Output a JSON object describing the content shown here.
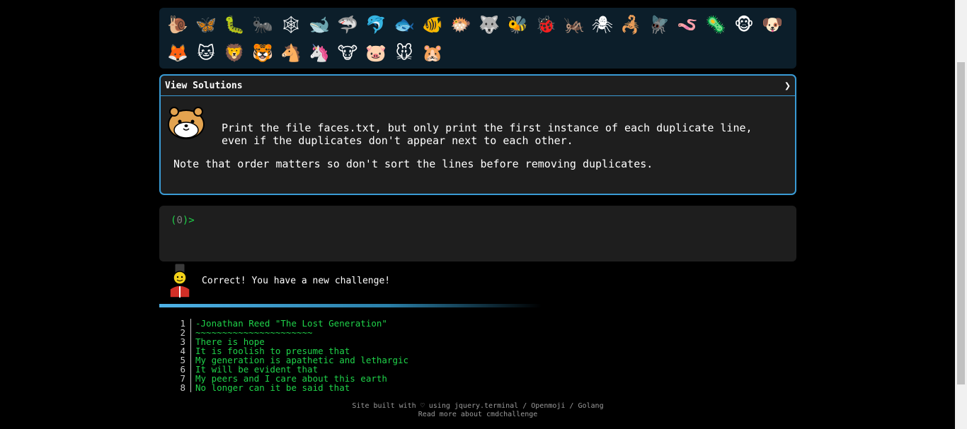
{
  "emoji_panel": {
    "icons": [
      {
        "name": "snail-icon",
        "glyph": "🐌"
      },
      {
        "name": "butterfly-icon",
        "glyph": "🦋"
      },
      {
        "name": "caterpillar-icon",
        "glyph": "🐛"
      },
      {
        "name": "ant-icon",
        "glyph": "🐜"
      },
      {
        "name": "spider-web-icon",
        "glyph": "🕸"
      },
      {
        "name": "whale-icon",
        "glyph": "🐋"
      },
      {
        "name": "shark-icon",
        "glyph": "🦈"
      },
      {
        "name": "dolphin-icon",
        "glyph": "🐬"
      },
      {
        "name": "fish-icon",
        "glyph": "🐟"
      },
      {
        "name": "tropical-fish-icon",
        "glyph": "🐠"
      },
      {
        "name": "blowfish-icon",
        "glyph": "🐡"
      },
      {
        "name": "wolf-icon",
        "glyph": "🐺"
      },
      {
        "name": "bee-icon",
        "glyph": "🐝"
      },
      {
        "name": "ladybug-icon",
        "glyph": "🐞"
      },
      {
        "name": "cricket-icon",
        "glyph": "🦗"
      },
      {
        "name": "spider-icon",
        "glyph": "🕷"
      },
      {
        "name": "scorpion-icon",
        "glyph": "🦂"
      },
      {
        "name": "fly-icon",
        "glyph": "🪰"
      },
      {
        "name": "worm-icon",
        "glyph": "🪱"
      },
      {
        "name": "microbe-icon",
        "glyph": "🦠"
      },
      {
        "name": "monkey-icon",
        "glyph": "🐵"
      },
      {
        "name": "dog-icon",
        "glyph": "🐶"
      },
      {
        "name": "fox-icon",
        "glyph": "🦊"
      },
      {
        "name": "cat-icon",
        "glyph": "🐱"
      },
      {
        "name": "lion-icon",
        "glyph": "🦁"
      },
      {
        "name": "tiger-icon",
        "glyph": "🐯"
      },
      {
        "name": "horse-icon",
        "glyph": "🐴"
      },
      {
        "name": "unicorn-icon",
        "glyph": "🦄"
      },
      {
        "name": "cow-icon",
        "glyph": "🐮"
      },
      {
        "name": "pig-icon",
        "glyph": "🐷"
      },
      {
        "name": "mouse-icon",
        "glyph": "🐭"
      },
      {
        "name": "hamster-icon",
        "glyph": "🐹"
      }
    ]
  },
  "challenge": {
    "toggle_label": "View Solutions",
    "chevron": "❯",
    "text_main": "Print the file faces.txt, but only print the first instance of each duplicate line, even if the duplicates don't appear next to each other.",
    "text_note": "Note that order matters so don't sort the lines before removing duplicates."
  },
  "terminal": {
    "prompt_open": "(",
    "prompt_count": "0",
    "prompt_close": ")>"
  },
  "message": {
    "text": "Correct! You have a new challenge!"
  },
  "progress": {
    "fraction": 0.6
  },
  "output": {
    "lines": [
      {
        "n": "1",
        "t": "-Jonathan Reed \"The Lost Generation\""
      },
      {
        "n": "2",
        "t": "~~~~~~~~~~~~~~~~~~~~~~"
      },
      {
        "n": "3",
        "t": "There is hope"
      },
      {
        "n": "4",
        "t": "It is foolish to presume that"
      },
      {
        "n": "5",
        "t": "My generation is apathetic and lethargic"
      },
      {
        "n": "6",
        "t": "It will be evident that"
      },
      {
        "n": "7",
        "t": "My peers and I care about this earth"
      },
      {
        "n": "8",
        "t": "No longer can it be said that"
      }
    ]
  },
  "footer": {
    "line1": "Site built with ♡ using jquery.terminal / Openmoji / Golang",
    "line2": "Read more about cmdchallenge"
  },
  "colors": {
    "accent": "#3a9bd5",
    "terminal_green": "#1fd34a",
    "panel_bg": "#0c1e2a"
  }
}
